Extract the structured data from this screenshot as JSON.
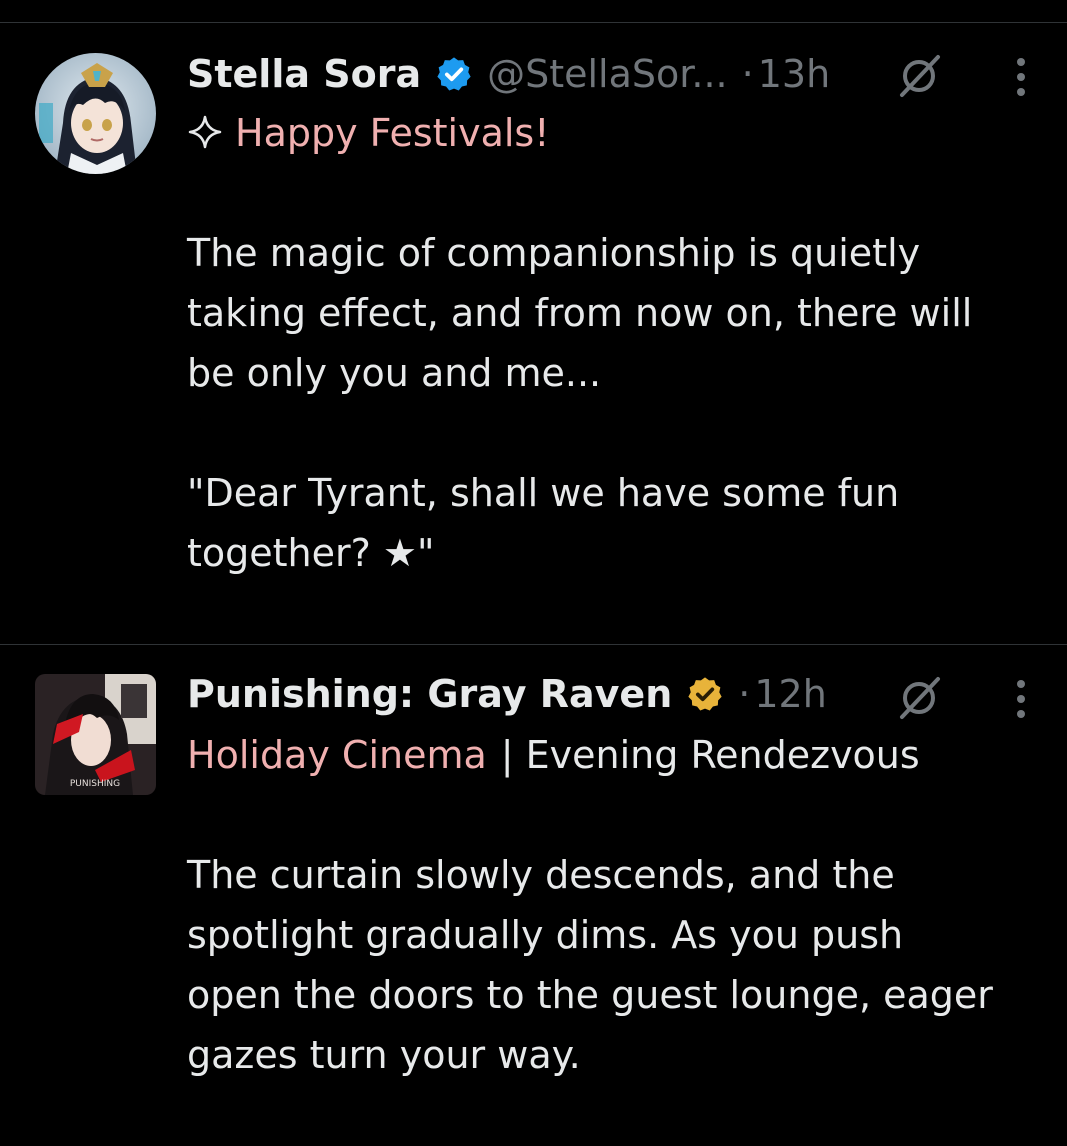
{
  "tweets": [
    {
      "name": "Stella Sora",
      "handle": "@StellaSor...",
      "separator": "·",
      "time": "13h",
      "verified_color": "#1d9bf0",
      "icons": [
        "verified-badge-icon",
        "grok-icon",
        "more-options-icon",
        "sparkle-icon"
      ],
      "highlight": "Happy Festivals!",
      "lines": [
        "The magic of companionship is quietly",
        "taking effect, and from now on, there will",
        "be only you and me...",
        "\"Dear Tyrant, shall we have some fun",
        "together? ★\""
      ]
    },
    {
      "name": "Punishing: Gray Raven",
      "separator": "·",
      "time": "12h",
      "verified_color": "#e8b33a",
      "icons": [
        "verified-badge-icon",
        "grok-icon",
        "more-options-icon"
      ],
      "highlight": "Holiday Cinema",
      "title_rest": "| Evening Rendezvous",
      "avatar_text": "PUNISHING",
      "lines": [
        "The curtain slowly descends, and the",
        "spotlight gradually dims. As you push",
        "open the doors to the guest lounge, eager",
        "gazes turn your way."
      ]
    }
  ],
  "colors": {
    "background": "#000000",
    "text": "#e7e9ea",
    "muted": "#71767b",
    "highlight_fill": "#6b0c0f",
    "highlight_text": "#f0b0b0"
  }
}
